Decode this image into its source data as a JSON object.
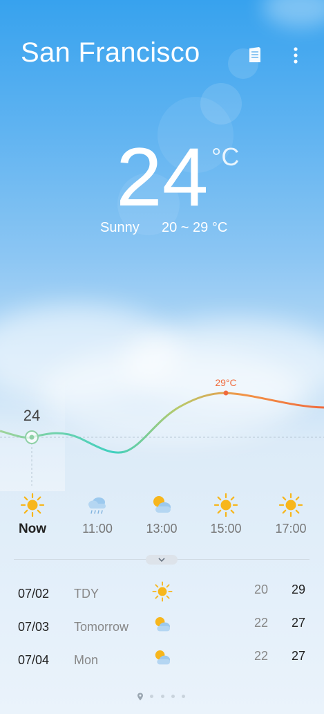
{
  "city": "San Francisco",
  "current": {
    "temperature": "24",
    "unit": "°C",
    "condition": "Sunny",
    "range": "20 ~ 29 °C"
  },
  "toolbar": {
    "share_icon": "share-icon",
    "more_icon": "more-vertical-icon"
  },
  "hourly_chart": {
    "current_label": "24",
    "peak_label": "29°C"
  },
  "hourly": [
    {
      "time": "Now",
      "icon": "sun-icon"
    },
    {
      "time": "11:00",
      "icon": "rain-cloud-icon"
    },
    {
      "time": "13:00",
      "icon": "partly-cloudy-icon"
    },
    {
      "time": "15:00",
      "icon": "sun-icon"
    },
    {
      "time": "17:00",
      "icon": "sun-icon"
    }
  ],
  "daily": [
    {
      "date": "07/02",
      "day": "TDY",
      "icon": "sun-icon",
      "low": "20",
      "high": "29"
    },
    {
      "date": "07/03",
      "day": "Tomorrow",
      "icon": "partly-cloudy-icon",
      "low": "22",
      "high": "27"
    },
    {
      "date": "07/04",
      "day": "Mon",
      "icon": "partly-cloudy-icon",
      "low": "22",
      "high": "27"
    }
  ],
  "pager": {
    "pages": 5,
    "current": 0
  },
  "colors": {
    "sky_top": "#37a2ee",
    "sun": "#f7b61c",
    "curve_start": "#7ed28f",
    "curve_end": "#f06a3c",
    "peak_label": "#f06a3c"
  }
}
